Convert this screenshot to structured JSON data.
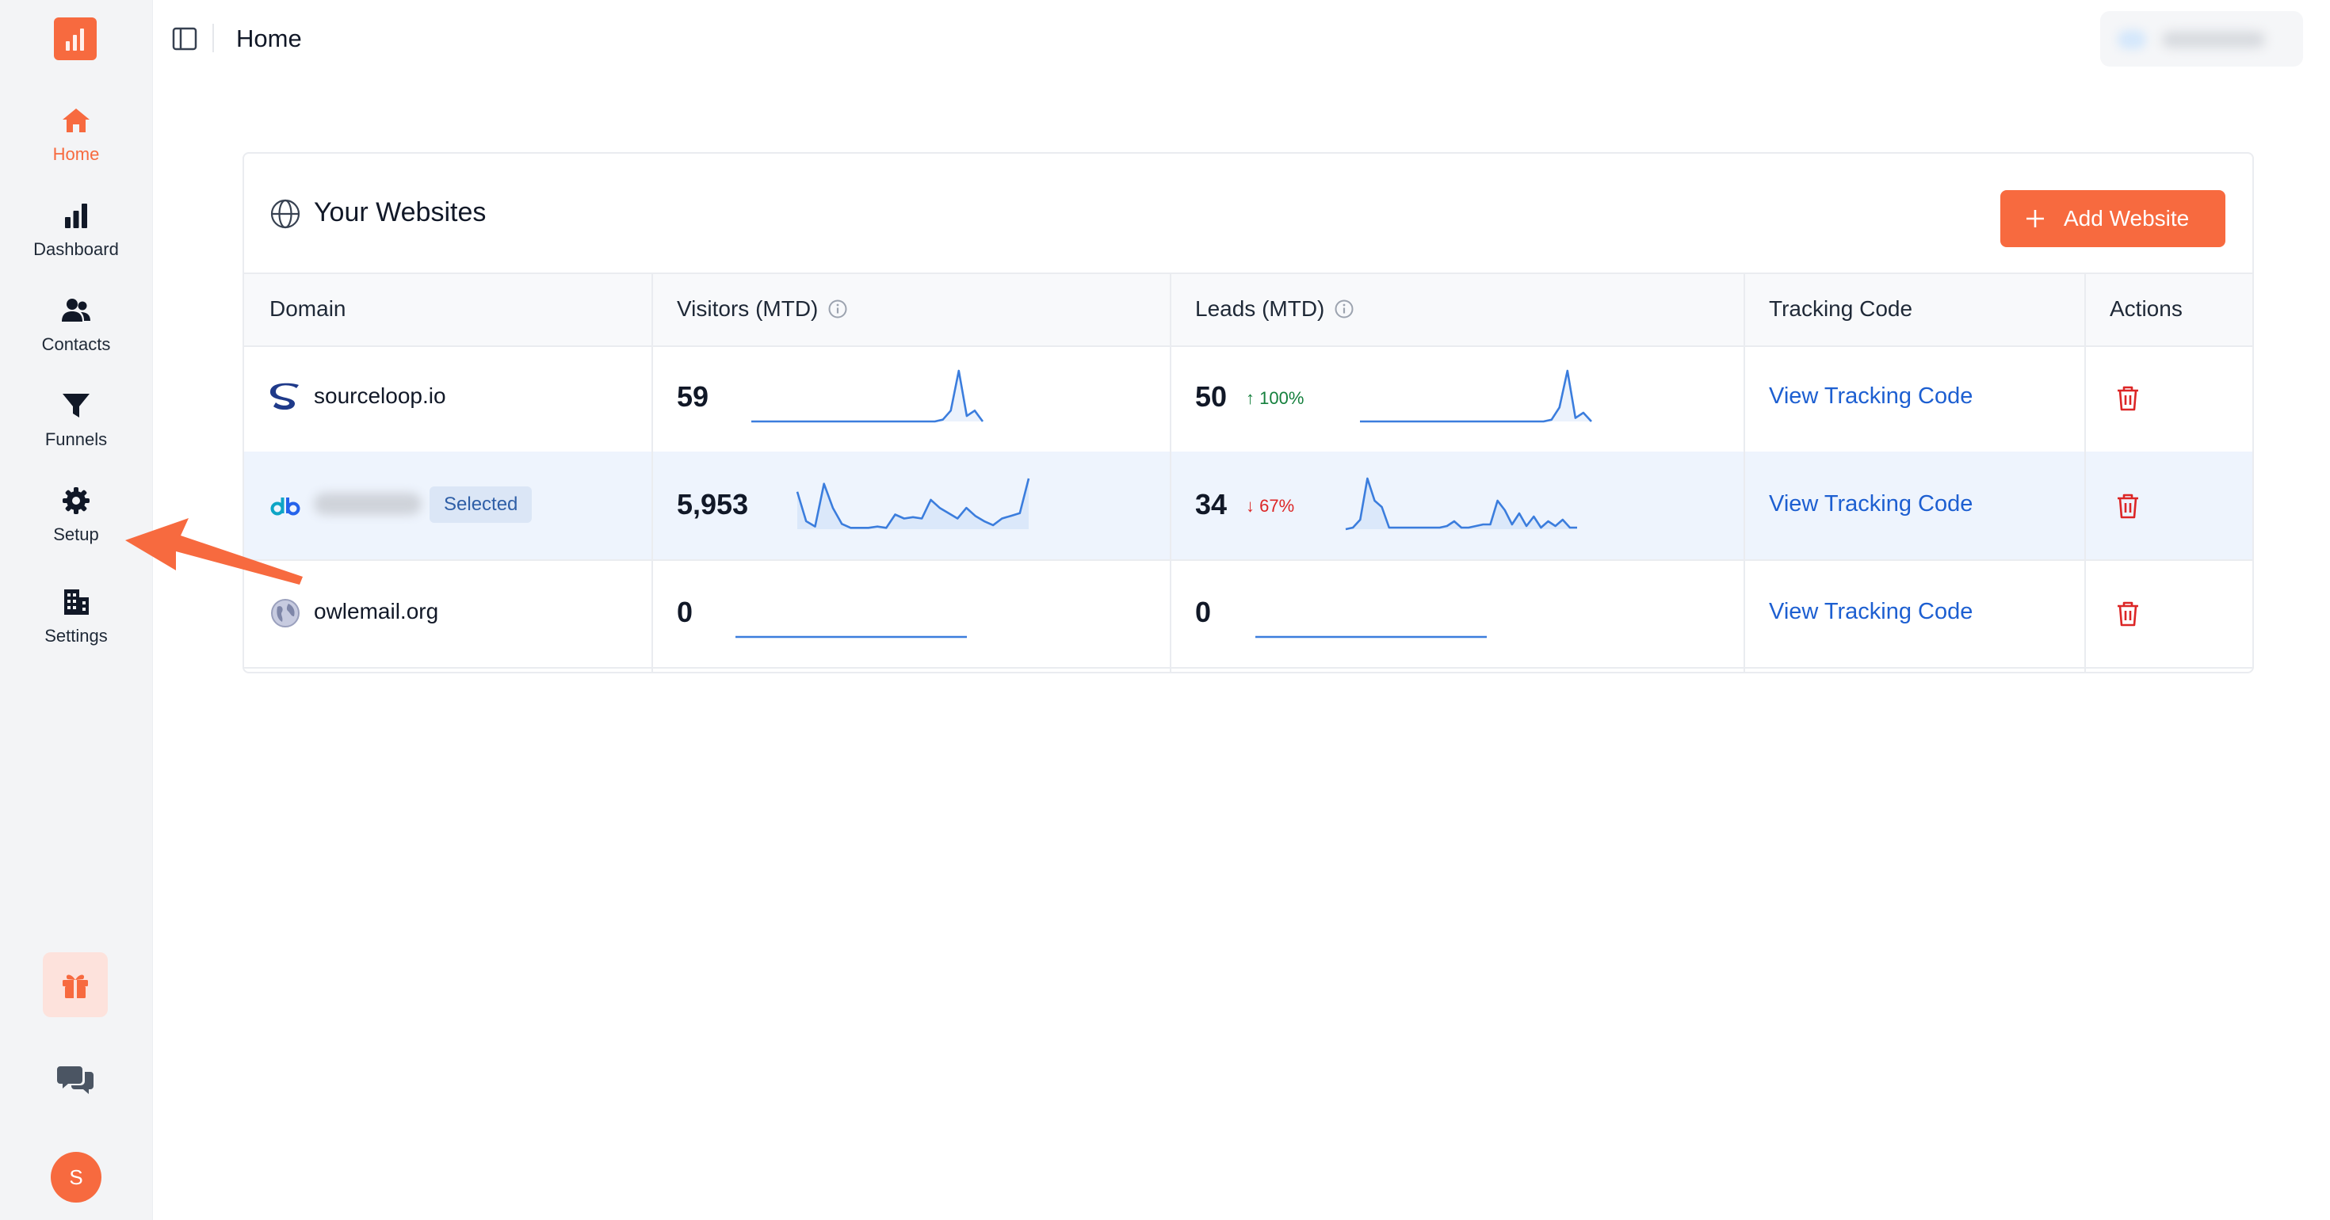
{
  "colors": {
    "accent": "#f76a3f",
    "link": "#1d5fd1",
    "up": "#15803d",
    "down": "#dc2626",
    "spark": "#3b7ddd"
  },
  "sidebar": {
    "logo_icon": "bar-chart-logo-icon",
    "items": [
      {
        "label": "Home",
        "icon": "home-icon",
        "active": true
      },
      {
        "label": "Dashboard",
        "icon": "bar-chart-icon",
        "active": false
      },
      {
        "label": "Contacts",
        "icon": "users-icon",
        "active": false
      },
      {
        "label": "Funnels",
        "icon": "funnel-icon",
        "active": false
      },
      {
        "label": "Setup",
        "icon": "gear-icon",
        "active": false
      },
      {
        "label": "Settings",
        "icon": "building-icon",
        "active": false
      }
    ],
    "bottom": {
      "gift_icon": "gift-icon",
      "chat_icon": "chat-bubbles-icon",
      "avatar_initial": "S"
    }
  },
  "header": {
    "title": "Home",
    "toggle_icon": "sidebar-toggle-icon"
  },
  "websites": {
    "title": "Your Websites",
    "add_button": "Add Website",
    "columns": [
      "Domain",
      "Visitors (MTD)",
      "Leads (MTD)",
      "Tracking Code",
      "Actions"
    ],
    "rows": [
      {
        "domain": "sourceloop.io",
        "logo_icon": "sourceloop-s-logo-icon",
        "blurred": false,
        "badge": "",
        "visitors": "59",
        "visitors_trend": [
          0,
          0,
          0,
          0,
          0,
          0,
          0,
          0,
          0,
          0,
          0,
          0,
          0,
          0,
          0,
          0,
          0,
          0,
          0,
          0,
          0,
          0,
          0,
          0,
          1,
          6,
          28,
          3,
          6,
          0
        ],
        "leads": "50",
        "leads_delta": "100%",
        "leads_dir": "up",
        "leads_trend": [
          0,
          0,
          0,
          0,
          0,
          0,
          0,
          0,
          0,
          0,
          0,
          0,
          0,
          0,
          0,
          0,
          0,
          0,
          0,
          0,
          0,
          0,
          0,
          0,
          1,
          8,
          29,
          2,
          5,
          0
        ],
        "tracking_link": "View Tracking Code",
        "selected": false
      },
      {
        "domain": "",
        "logo_icon": "db-logo-icon",
        "blurred": true,
        "badge": "Selected",
        "visitors": "5,953",
        "visitors_trend": [
          28,
          6,
          2,
          34,
          16,
          4,
          1,
          1,
          1,
          2,
          1,
          11,
          8,
          9,
          8,
          22,
          16,
          12,
          8,
          16,
          10,
          6,
          3,
          8,
          10,
          12,
          38
        ],
        "leads": "34",
        "leads_delta": "67%",
        "leads_dir": "down",
        "leads_trend": [
          0,
          1,
          6,
          32,
          18,
          14,
          1,
          1,
          1,
          1,
          1,
          1,
          1,
          1,
          2,
          5,
          1,
          1,
          2,
          3,
          3,
          18,
          12,
          3,
          10,
          2,
          8,
          1,
          5,
          2,
          6,
          1,
          1
        ],
        "tracking_link": "View Tracking Code",
        "selected": true
      },
      {
        "domain": "owlemail.org",
        "logo_icon": "globe-logo-icon",
        "blurred": false,
        "badge": "",
        "visitors": "0",
        "visitors_trend": [
          0,
          0,
          0,
          0,
          0,
          0,
          0,
          0,
          0,
          0,
          0,
          0,
          0,
          0,
          0,
          0,
          0,
          0,
          0,
          0,
          0,
          0,
          0,
          0,
          0,
          0,
          0,
          0,
          0,
          0
        ],
        "leads": "0",
        "leads_delta": "",
        "leads_dir": "",
        "leads_trend": [
          0,
          0,
          0,
          0,
          0,
          0,
          0,
          0,
          0,
          0,
          0,
          0,
          0,
          0,
          0,
          0,
          0,
          0,
          0,
          0,
          0,
          0,
          0,
          0,
          0,
          0,
          0,
          0,
          0,
          0
        ],
        "tracking_link": "View Tracking Code",
        "selected": false
      }
    ]
  },
  "annotation": {
    "arrow_icon": "pointer-arrow-icon"
  }
}
